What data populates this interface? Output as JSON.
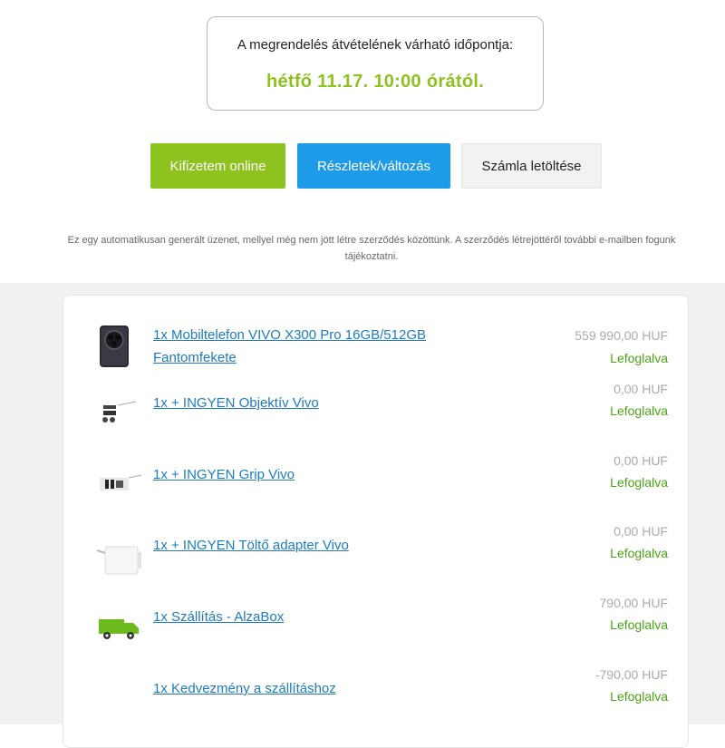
{
  "delivery": {
    "label": "A megrendelés átvételének várható időpontja:",
    "time": "hétfő 11.17. 10:00 órától."
  },
  "actions": {
    "pay_label": "Kifizetem online",
    "details_label": "Részletek/változás",
    "invoice_label": "Számla letöltése"
  },
  "notice": "Ez egy automatikusan generált üzenet, mellyel még nem jött létre szerződés közöttünk. A szerződés létrejöttéről további e-mailben fogunk tájékoztatni.",
  "colors": {
    "accent_green": "#8dc21f",
    "accent_blue": "#1e9be8",
    "status_green": "#4aa315",
    "link_blue": "#1e7bc0"
  },
  "items": [
    {
      "name": "1x Mobiltelefon VIVO X300 Pro 16GB/512GB Fantomfekete",
      "price": "559 990,00 HUF",
      "status": "Lefoglalva",
      "icon": "phone-icon"
    },
    {
      "name": "1x + INGYEN Objektív Vivo",
      "price": "0,00 HUF",
      "status": "Lefoglalva",
      "icon": "lens-kit-icon"
    },
    {
      "name": "1x + INGYEN Grip Vivo",
      "price": "0,00 HUF",
      "status": "Lefoglalva",
      "icon": "grip-kit-icon"
    },
    {
      "name": "1x + INGYEN Töltő adapter Vivo",
      "price": "0,00 HUF",
      "status": "Lefoglalva",
      "icon": "charger-icon"
    },
    {
      "name": "1x Szállítás - AlzaBox",
      "price": "790,00 HUF",
      "status": "Lefoglalva",
      "icon": "delivery-truck-icon"
    },
    {
      "name": "1x Kedvezmény a szállításhoz",
      "price": "-790,00 HUF",
      "status": "Lefoglalva",
      "icon": ""
    }
  ]
}
